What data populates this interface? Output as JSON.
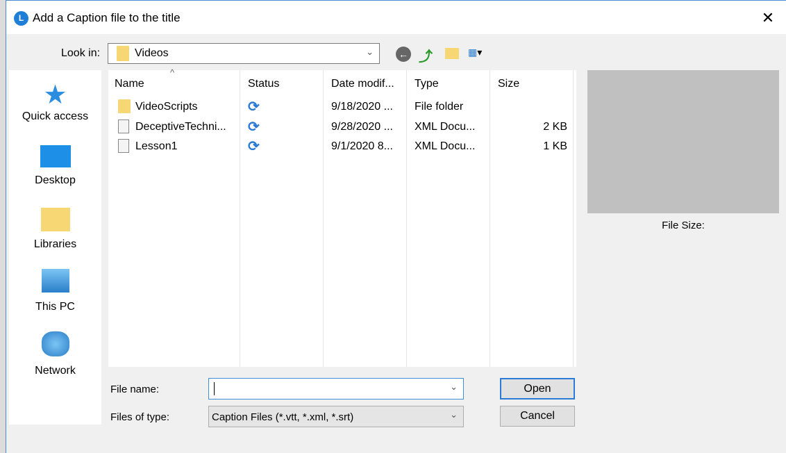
{
  "window": {
    "title": "Add a Caption file to the title",
    "app_icon": "L"
  },
  "look_in": {
    "label": "Look in:",
    "value": "Videos"
  },
  "toolbar": {
    "back": "back-icon",
    "up": "up-folder-icon",
    "new_folder": "new-folder-icon",
    "view": "view-menu-icon"
  },
  "places": [
    {
      "label": "Quick access",
      "icon": "star-icon"
    },
    {
      "label": "Desktop",
      "icon": "desktop-icon"
    },
    {
      "label": "Libraries",
      "icon": "libraries-icon"
    },
    {
      "label": "This PC",
      "icon": "computer-icon"
    },
    {
      "label": "Network",
      "icon": "network-icon"
    }
  ],
  "columns": [
    "Name",
    "Status",
    "Date modif...",
    "Type",
    "Size"
  ],
  "files": [
    {
      "name": "VideoScripts",
      "status": "sync",
      "date": "9/18/2020 ...",
      "type": "File folder",
      "size": "",
      "icon": "folder"
    },
    {
      "name": "DeceptiveTechni...",
      "status": "sync",
      "date": "9/28/2020 ...",
      "type": "XML Docu...",
      "size": "2 KB",
      "icon": "xml"
    },
    {
      "name": "Lesson1",
      "status": "sync",
      "date": "9/1/2020 8...",
      "type": "XML Docu...",
      "size": "1 KB",
      "icon": "xml"
    }
  ],
  "preview": {
    "file_size_label": "File Size:"
  },
  "file_name": {
    "label": "File name:",
    "value": ""
  },
  "file_type": {
    "label": "Files of type:",
    "value": "Caption Files (*.vtt, *.xml, *.srt)"
  },
  "buttons": {
    "open": "Open",
    "cancel": "Cancel"
  }
}
